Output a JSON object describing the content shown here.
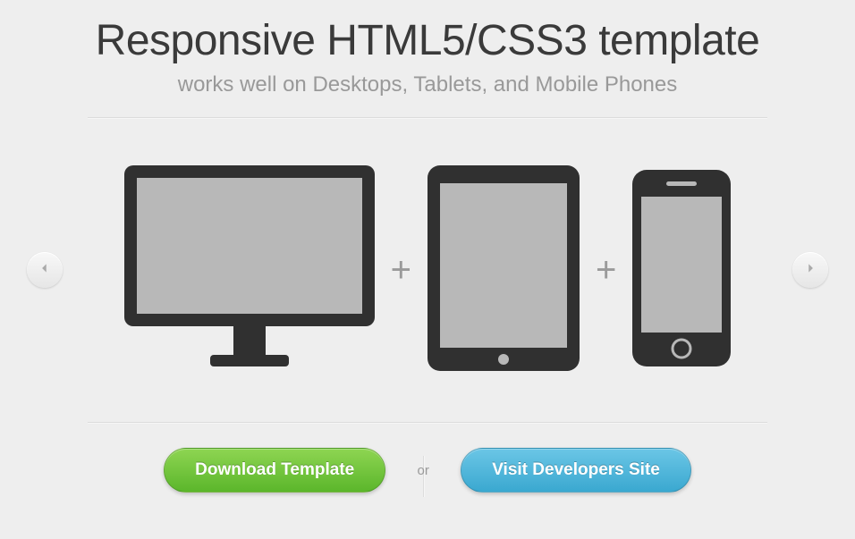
{
  "title": "Responsive HTML5/CSS3 template",
  "subtitle": "works well on Desktops, Tablets, and Mobile Phones",
  "plus_symbol": "+",
  "cta": {
    "download_label": "Download Template",
    "or_label": "or",
    "visit_label": "Visit Developers Site"
  },
  "colors": {
    "green_button": "#5bb62b",
    "blue_button": "#3aa8d0",
    "device_dark": "#303030",
    "device_screen": "#b8b8b8"
  },
  "icons": {
    "left_arrow": "chevron-left-icon",
    "right_arrow": "chevron-right-icon",
    "desktop": "desktop-monitor-icon",
    "tablet": "tablet-icon",
    "phone": "phone-icon"
  }
}
